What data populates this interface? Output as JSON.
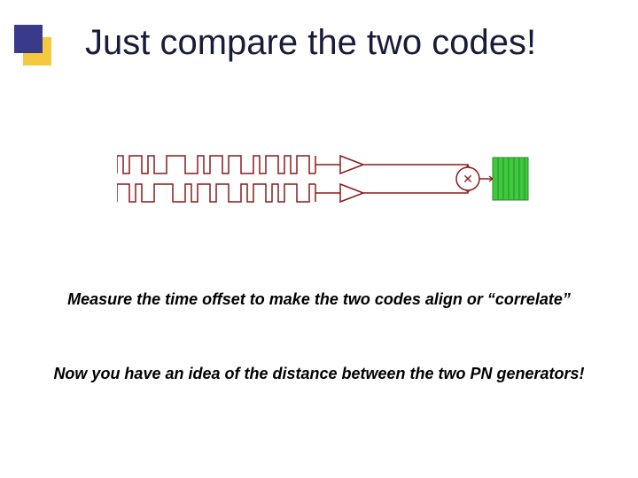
{
  "title": "Just compare the two codes!",
  "captions": {
    "measure": "Measure the time offset to make the two codes align or “correlate”",
    "distance": "Now you have an idea of the distance between the two PN generators!"
  },
  "diagram": {
    "code1_bits": [
      1,
      0,
      1,
      1,
      0,
      1,
      0,
      0,
      1,
      1,
      1,
      0,
      0,
      1,
      0,
      1,
      1,
      0,
      1,
      1,
      0,
      0,
      1,
      0,
      1,
      1,
      0,
      1,
      0,
      1,
      1,
      0
    ],
    "code2_bits": [
      1,
      1,
      0,
      1,
      0,
      0,
      1,
      1,
      1,
      0,
      0,
      1,
      0,
      1,
      1,
      0,
      1,
      1,
      0,
      0,
      1,
      0,
      1,
      1,
      0,
      1,
      0,
      1,
      1,
      0,
      0,
      1
    ],
    "multiplier_symbol": "✕",
    "colors": {
      "signal_stroke": "#8b1a1a",
      "accent_fill": "#3ec93e",
      "triangle_stroke": "#8b1a1a"
    }
  }
}
